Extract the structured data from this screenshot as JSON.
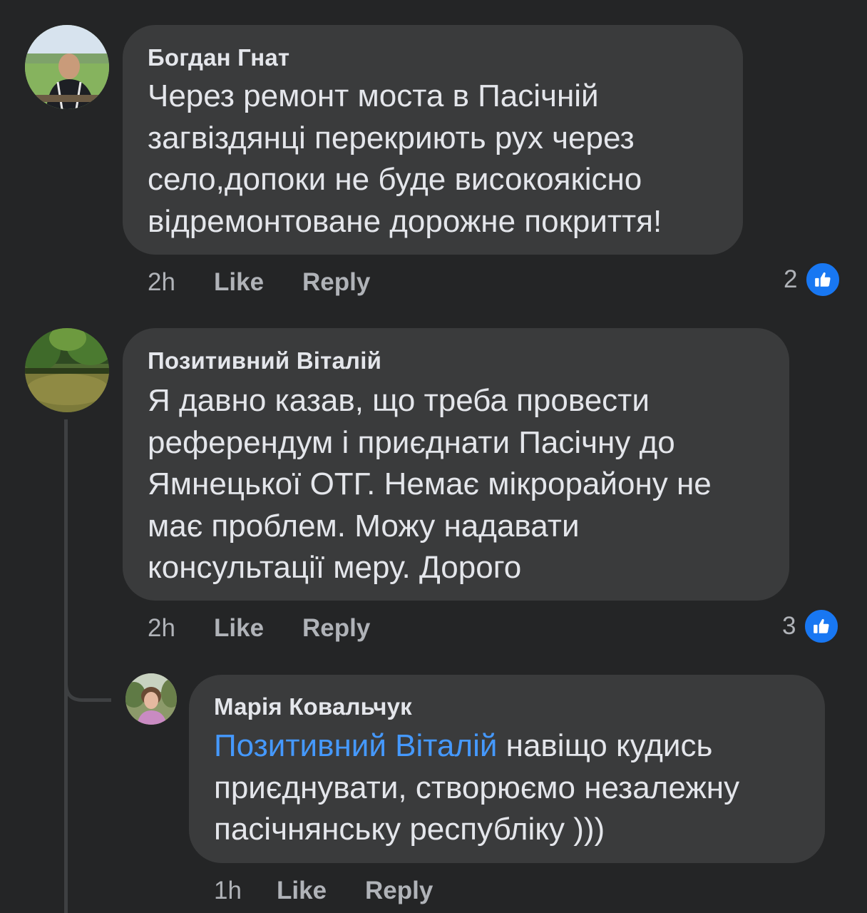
{
  "comments": [
    {
      "author": "Богдан Гнат",
      "lines": [
        "Через ремонт моста в Пасічній",
        "загвіздянці перекриють рух через",
        "село,допоки не буде високоякісно",
        "відремонтоване дорожне покриття!"
      ],
      "time": "2h",
      "like": "Like",
      "reply": "Reply",
      "reactions": "2",
      "reaction_icon": "like-icon"
    },
    {
      "author": "Позитивний Віталій",
      "lines": [
        "Я давно казав, що треба провести",
        "референдум і приєднати Пасічну до",
        "Ямнецької ОТГ. Немає мікрорайону не",
        "має проблем. Можу надавати",
        "консультації меру. Дорого"
      ],
      "time": "2h",
      "like": "Like",
      "reply": "Reply",
      "reactions": "3",
      "reaction_icon": "like-icon"
    },
    {
      "author": "Марія Ковальчук",
      "mention": "Позитивний Віталій",
      "lines": [
        " навіщо кудись",
        "приєднувати, створюємо незалежну",
        "пасічнянську республіку )))"
      ],
      "time": "1h",
      "like": "Like",
      "reply": "Reply"
    }
  ],
  "colors": {
    "background": "#242526",
    "bubble": "#3a3b3c",
    "text": "#e4e6eb",
    "secondary_text": "#b0b3b8",
    "mention": "#4599ff",
    "like_badge": "#1877f2"
  }
}
